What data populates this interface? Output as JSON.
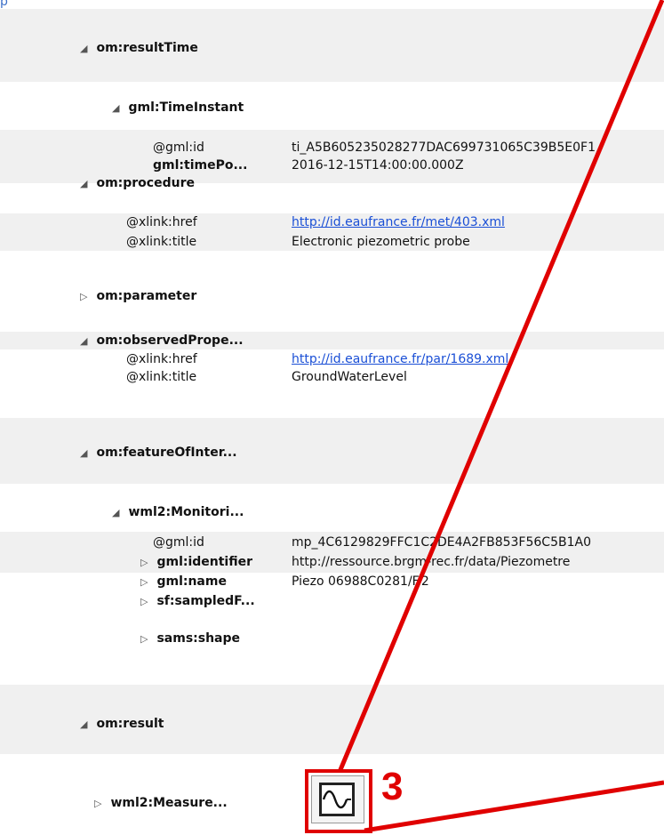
{
  "top_fragment": "p",
  "tree": [
    {
      "key": "om:resultTime",
      "expanded": true
    },
    {
      "key": "gml:TimeInstant",
      "expanded": true
    },
    {
      "key": "@gml:id",
      "value": "ti_A5B605235028277DAC699731065C39B5E0F1"
    },
    {
      "key": "gml:timePo...",
      "value": "2016-12-15T14:00:00.000Z"
    },
    {
      "key": "om:procedure",
      "expanded": true
    },
    {
      "key": "@xlink:href",
      "value": "http://id.eaufrance.fr/met/403.xml"
    },
    {
      "key": "@xlink:title",
      "value": "Electronic piezometric probe"
    },
    {
      "key": "om:parameter",
      "expanded": false
    },
    {
      "key": "om:observedPrope...",
      "expanded": true
    },
    {
      "key": "@xlink:href",
      "value": "http://id.eaufrance.fr/par/1689.xml"
    },
    {
      "key": "@xlink:title",
      "value": "GroundWaterLevel"
    },
    {
      "key": "om:featureOfInter...",
      "expanded": true
    },
    {
      "key": "wml2:Monitori...",
      "expanded": true
    },
    {
      "key": "@gml:id",
      "value": "mp_4C6129829FFC1C2DE4A2FB853F56C5B1A0"
    },
    {
      "key": "gml:identifier",
      "value": "http://ressource.brgm-rec.fr/data/Piezometre",
      "expanded": false
    },
    {
      "key": "gml:name",
      "value": "Piezo 06988C0281/F.2",
      "expanded": false
    },
    {
      "key": "sf:sampledF...",
      "expanded": false
    },
    {
      "key": "sams:shape",
      "expanded": false
    },
    {
      "key": "om:result",
      "expanded": true
    },
    {
      "key": "wml2:Measure...",
      "expanded": false
    }
  ],
  "icons": {
    "expanded": "triangle-expanded-icon",
    "collapsed": "triangle-collapsed-icon",
    "chart": "waveform-chart-icon"
  },
  "annotation": {
    "label": "3",
    "color": "#e00000"
  },
  "colors": {
    "band": "#f0f0f0",
    "link": "#1a4fd6",
    "accent": "#e00000"
  }
}
